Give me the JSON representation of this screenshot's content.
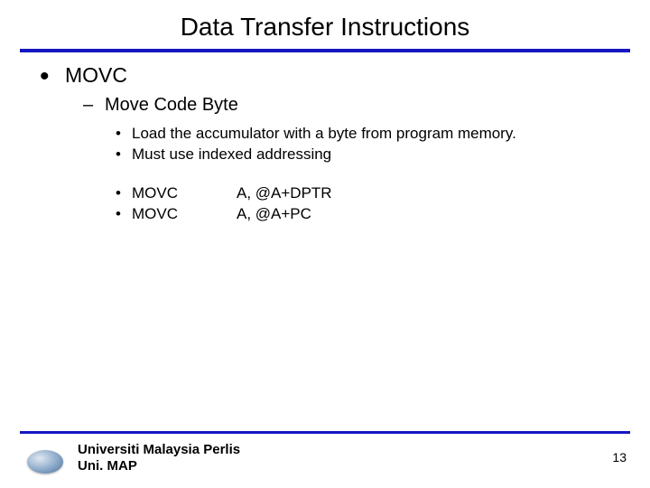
{
  "title": "Data Transfer Instructions",
  "level1": {
    "label": "MOVC"
  },
  "level2": {
    "label": "Move Code Byte"
  },
  "desc": [
    "Load the accumulator with a byte from program memory.",
    "Must use indexed addressing"
  ],
  "code": [
    {
      "mnemonic": "MOVC",
      "operands": "A, @A+DPTR"
    },
    {
      "mnemonic": "MOVC",
      "operands": "A, @A+PC"
    }
  ],
  "footer": {
    "line1": "Universiti Malaysia Perlis",
    "line2": "Uni. MAP"
  },
  "page": "13",
  "colors": {
    "rule": "#1616c2"
  }
}
